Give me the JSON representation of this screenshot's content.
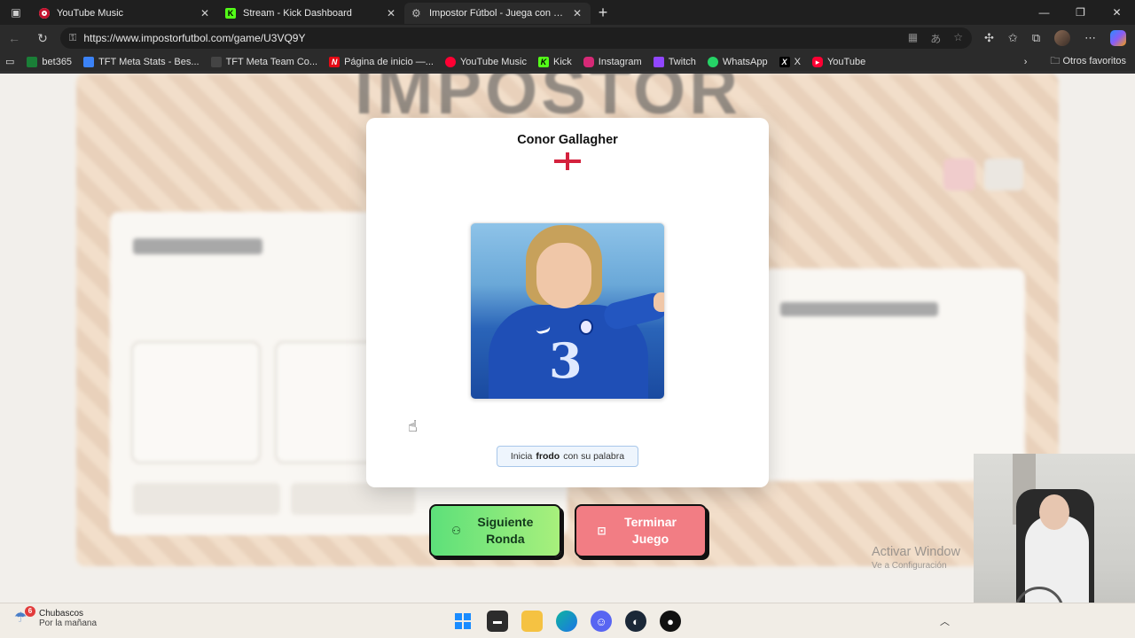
{
  "browser": {
    "tabs": [
      {
        "title": "YouTube Music",
        "icon": "youtube-music-icon"
      },
      {
        "title": "Stream - Kick Dashboard",
        "icon": "kick-icon"
      },
      {
        "title": "Impostor Fútbol - Juega con amig",
        "icon": "gear-icon",
        "active": true
      }
    ],
    "url": "https://www.impostorfutbol.com/game/U3VQ9Y",
    "bookmarks": [
      {
        "label": "bet365",
        "color": "#1a7f37"
      },
      {
        "label": "TFT Meta Stats - Bes...",
        "color": "#3b82f6"
      },
      {
        "label": "TFT Meta Team Co...",
        "color": "#444444"
      },
      {
        "label": "Página de inicio —...",
        "color": "#e50914"
      },
      {
        "label": "YouTube Music",
        "color": "#ff0033"
      },
      {
        "label": "Kick",
        "color": "#53fc18"
      },
      {
        "label": "Instagram",
        "color": "#d62976"
      },
      {
        "label": "Twitch",
        "color": "#9146ff"
      },
      {
        "label": "WhatsApp",
        "color": "#25d366"
      },
      {
        "label": "X",
        "color": "#000000"
      },
      {
        "label": "YouTube",
        "color": "#ff0033"
      }
    ],
    "other_bookmarks": "Otros favoritos"
  },
  "modal": {
    "player_name": "Conor Gallagher",
    "flag": "england-flag-icon",
    "hint_prefix": "Inicia",
    "hint_player": "frodo",
    "hint_suffix": "con su palabra"
  },
  "actions": {
    "next_round": "Siguiente Ronda",
    "end_game": "Terminar Juego"
  },
  "watermark": {
    "title": "Activar Window",
    "subtitle": "Ve a Configuración"
  },
  "taskbar": {
    "weather_badge": "6",
    "weather_title": "Chubascos",
    "weather_subtitle": "Por la mañana"
  },
  "colors": {
    "accent_green": "#5de07a",
    "accent_red": "#f27d84",
    "hint_border": "#a8c7ea"
  }
}
